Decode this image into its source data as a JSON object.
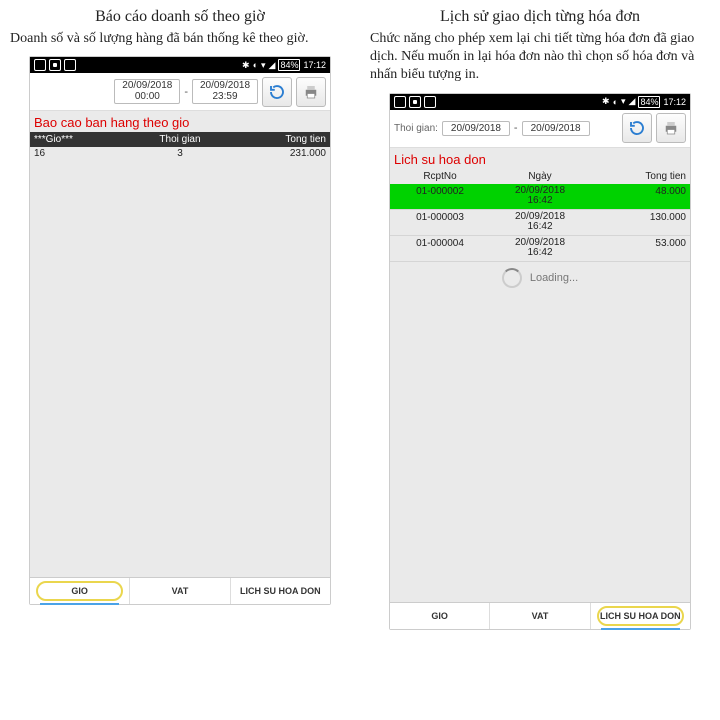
{
  "left": {
    "title": "Báo cáo doanh số theo giờ",
    "desc": "Doanh số và số lượng hàng đã bán thống kê theo giờ.",
    "status": {
      "battery": "84%",
      "time": "17:12"
    },
    "filter": {
      "from_date": "20/09/2018",
      "from_time": "00:00",
      "to_date": "20/09/2018",
      "to_time": "23:59",
      "dash": "-"
    },
    "header": "Bao cao ban hang theo gio",
    "cols": {
      "c1": "***Gio***",
      "c2": "Thoi gian",
      "c3": "Tong tien"
    },
    "row": {
      "hour": "16",
      "count": "3",
      "amount": "231.000"
    },
    "tabs": {
      "t1": "GIO",
      "t2": "VAT",
      "t3": "LICH SU HOA DON"
    }
  },
  "right": {
    "title": "Lịch sử giao dịch từng hóa đơn",
    "desc": "Chức năng cho phép xem lại chi tiết từng hóa đơn đã giao dịch. Nếu muốn in lại hóa đơn nào thì chọn số hóa đơn và nhấn biểu tượng in.",
    "status": {
      "battery": "84%",
      "time": "17:12"
    },
    "filter": {
      "label": "Thoi gian:",
      "from_date": "20/09/2018",
      "to_date": "20/09/2018",
      "dash": "-"
    },
    "header": "Lich su hoa don",
    "cols": {
      "c1": "RcptNo",
      "c2": "Ngày",
      "c3": "Tong tien"
    },
    "rows": [
      {
        "rcpt": "01-000002",
        "date": "20/09/2018",
        "time": "16:42",
        "amount": "48.000",
        "hl": true
      },
      {
        "rcpt": "01-000003",
        "date": "20/09/2018",
        "time": "16:42",
        "amount": "130.000",
        "hl": false
      },
      {
        "rcpt": "01-000004",
        "date": "20/09/2018",
        "time": "16:42",
        "amount": "53.000",
        "hl": false
      }
    ],
    "loading": "Loading...",
    "tabs": {
      "t1": "GIO",
      "t2": "VAT",
      "t3": "LICH SU HOA DON"
    }
  }
}
